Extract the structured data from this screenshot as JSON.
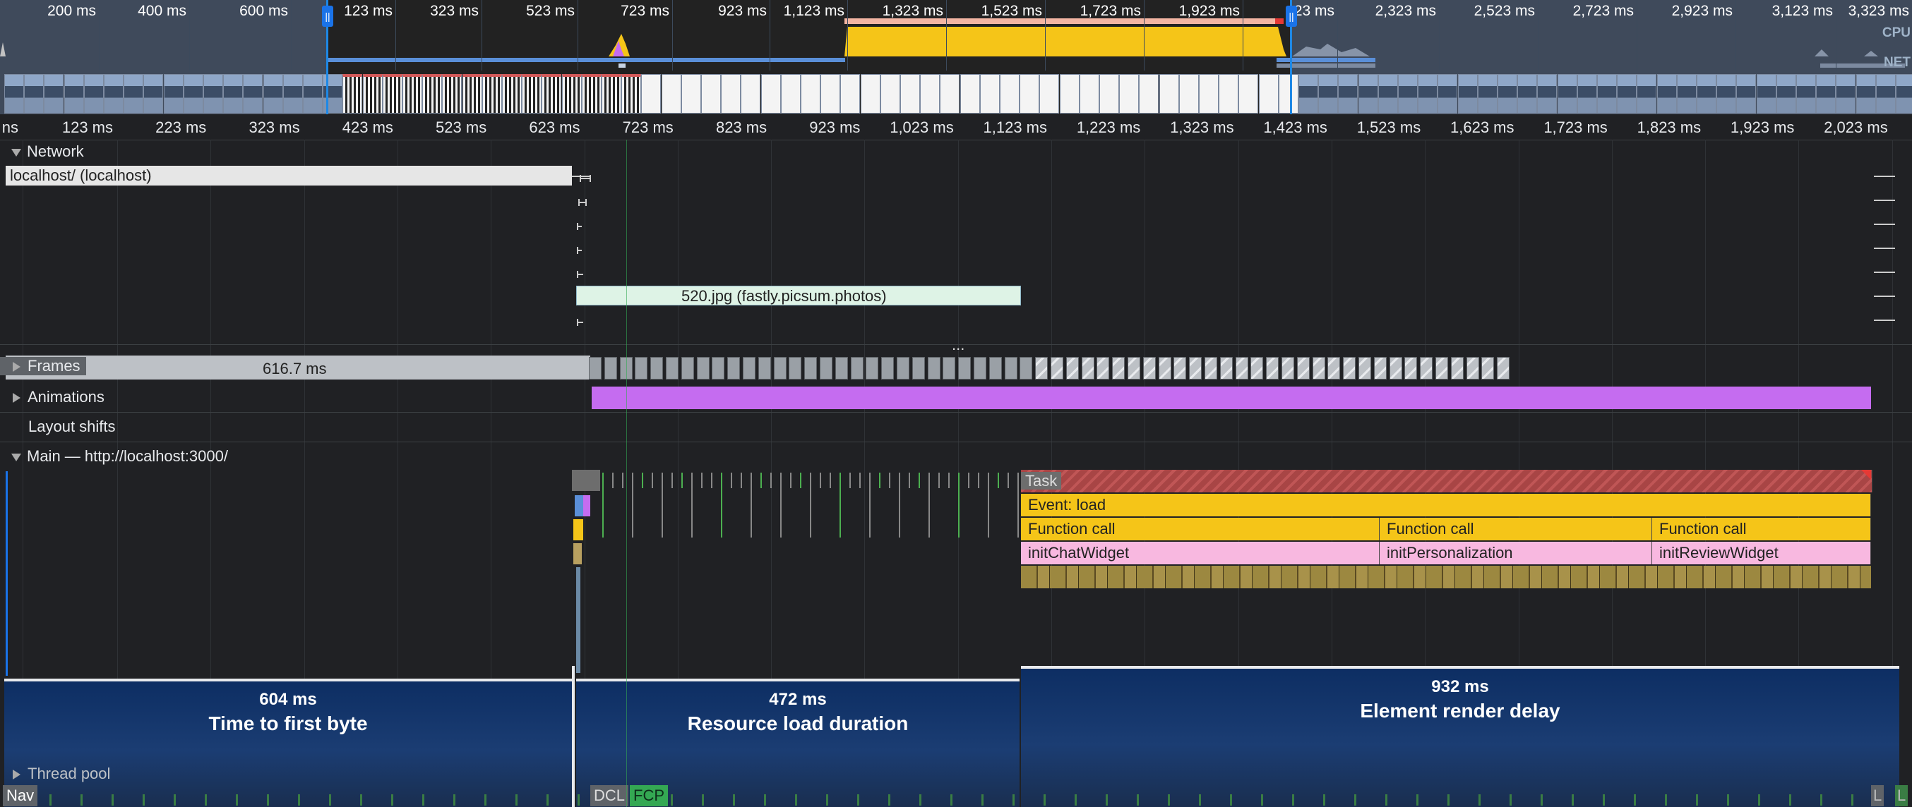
{
  "overview": {
    "ticks": [
      "200 ms",
      "400 ms",
      "600 ms",
      "123 ms",
      "323 ms",
      "523 ms",
      "723 ms",
      "923 ms",
      "1,123 ms",
      "1,323 ms",
      "1,523 ms",
      "1,723 ms",
      "1,923 ms",
      "23 ms",
      "2,323 ms",
      "2,523 ms",
      "2,723 ms",
      "2,923 ms",
      "3,123 ms",
      "3,323 ms"
    ],
    "cpu_label": "CPU",
    "net_label": "NET",
    "handle_glyph": "||"
  },
  "ruler": {
    "ticks": [
      "ns",
      "123 ms",
      "223 ms",
      "323 ms",
      "423 ms",
      "523 ms",
      "623 ms",
      "723 ms",
      "823 ms",
      "923 ms",
      "1,023 ms",
      "1,123 ms",
      "1,223 ms",
      "1,323 ms",
      "1,423 ms",
      "1,523 ms",
      "1,623 ms",
      "1,723 ms",
      "1,823 ms",
      "1,923 ms",
      "2,023 ms"
    ]
  },
  "network": {
    "title": "Network",
    "requests": [
      {
        "label": "localhost/ (localhost)"
      },
      {
        "label": "520.jpg (fastly.picsum.photos)"
      }
    ],
    "more": "..."
  },
  "frames": {
    "title": "Frames",
    "duration": "616.7 ms"
  },
  "animations": {
    "title": "Animations"
  },
  "layout_shifts": {
    "title": "Layout shifts"
  },
  "main": {
    "title": "Main — http://localhost:3000/",
    "task": "Task",
    "event": "Event: load",
    "calls": [
      "Function call",
      "Function call",
      "Function call"
    ],
    "functions": [
      "initChatWidget",
      "initPersonalization",
      "initReviewWidget"
    ]
  },
  "phases": [
    {
      "value": "604 ms",
      "label": "Time to first byte"
    },
    {
      "value": "472 ms",
      "label": "Resource load duration"
    },
    {
      "value": "932 ms",
      "label": "Element render delay"
    }
  ],
  "thread_pool": {
    "title": "Thread pool"
  },
  "markers": {
    "nav": "Nav",
    "dcl": "DCL",
    "fcp": "FCP",
    "l1": "L",
    "l2": "L"
  },
  "colors": {
    "scripting": "#f5c518",
    "rendering": "#c56cf0",
    "painting": "#4caf50",
    "selection": "#1e88e5",
    "task_long": "#b54a4a",
    "function": "#f8b8e0"
  }
}
